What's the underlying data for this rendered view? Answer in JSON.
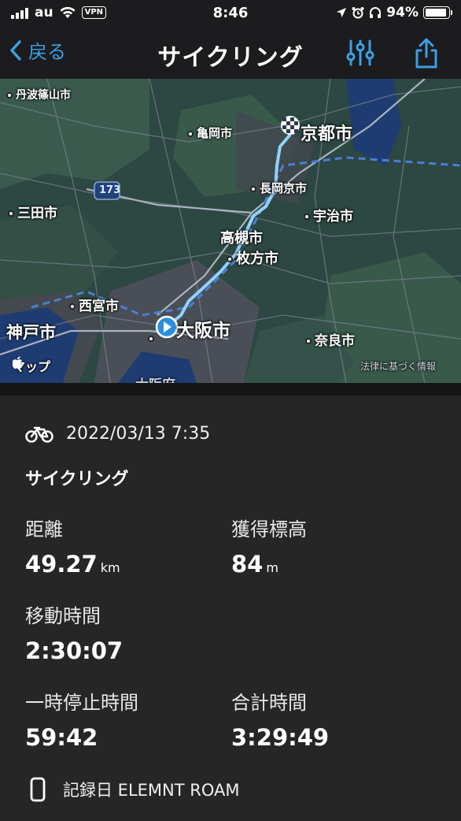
{
  "status_bar": {
    "carrier": "au",
    "vpn": "VPN",
    "time": "8:46",
    "battery": "94%",
    "battery_level": 0.94
  },
  "nav": {
    "back_label": "戻る",
    "title": "サイクリング"
  },
  "map": {
    "labels": {
      "tamba": "丹波篠山市",
      "kameoka": "亀岡市",
      "kyoto": "京都市",
      "nagaokakyo": "長岡京市",
      "route173": "173",
      "sanda": "三田市",
      "uji": "宇治市",
      "takatsuki": "高槻市",
      "hirakata": "枚方市",
      "nishinomiya": "西宮市",
      "kobe": "神戸市",
      "osaka": "大阪市",
      "nara": "奈良市",
      "osaka_pref": "大阪府"
    },
    "attribution": "マップ",
    "legal": "法律に基づく情報"
  },
  "activity": {
    "datetime": "2022/03/13 7:35",
    "type": "サイクリング",
    "stats": {
      "distance": {
        "label": "距離",
        "value": "49.27",
        "unit": "km"
      },
      "elevation": {
        "label": "獲得標高",
        "value": "84",
        "unit": "m"
      },
      "moving": {
        "label": "移動時間",
        "value": "2:30:07"
      },
      "stopped": {
        "label": "一時停止時間",
        "value": "59:42"
      },
      "total": {
        "label": "合計時間",
        "value": "3:29:49"
      }
    },
    "device": "記録日 ELEMNT ROAM"
  },
  "colors": {
    "accent": "#3aa0e6",
    "route": "#8fd3ff",
    "background": "#262626"
  }
}
